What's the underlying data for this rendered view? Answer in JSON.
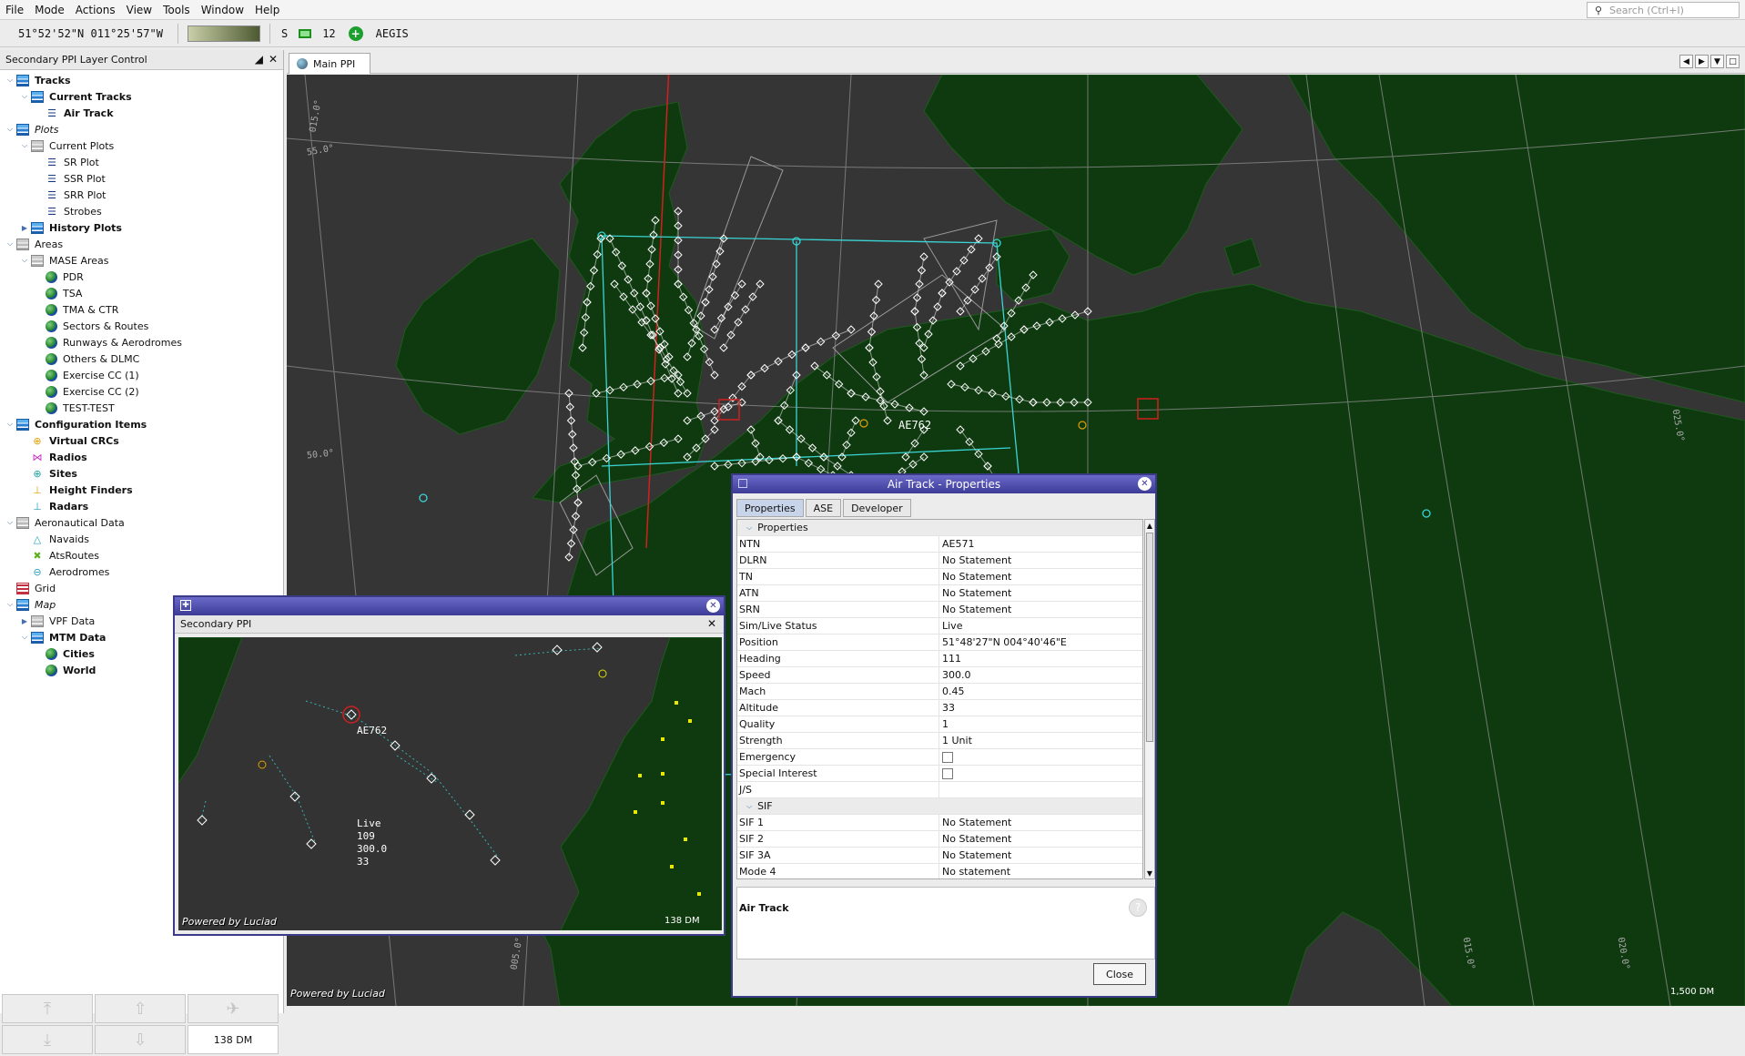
{
  "menu": [
    "File",
    "Mode",
    "Actions",
    "View",
    "Tools",
    "Window",
    "Help"
  ],
  "search": {
    "placeholder": "Search (Ctrl+I)"
  },
  "toolbar": {
    "coordinates": "51°52'52\"N 011°25'57\"W",
    "mode_letter": "S",
    "count": "12",
    "system": "AEGIS"
  },
  "left_panel": {
    "title": "Secondary PPI Layer Control",
    "tree": [
      {
        "label": "Tracks",
        "level": 0,
        "icon": "layer",
        "style": "b",
        "toggle": "open"
      },
      {
        "label": "Current Tracks",
        "level": 1,
        "icon": "layer",
        "style": "b",
        "toggle": "open"
      },
      {
        "label": "Air Track",
        "level": 2,
        "icon": "list",
        "style": "b",
        "toggle": ""
      },
      {
        "label": "Plots",
        "level": 0,
        "icon": "layer",
        "style": "i",
        "toggle": "open"
      },
      {
        "label": "Current Plots",
        "level": 1,
        "icon": "grey",
        "style": "",
        "toggle": "open"
      },
      {
        "label": "SR Plot",
        "level": 2,
        "icon": "list",
        "style": "",
        "toggle": ""
      },
      {
        "label": "SSR Plot",
        "level": 2,
        "icon": "list",
        "style": "",
        "toggle": ""
      },
      {
        "label": "SRR Plot",
        "level": 2,
        "icon": "list",
        "style": "",
        "toggle": ""
      },
      {
        "label": "Strobes",
        "level": 2,
        "icon": "list",
        "style": "",
        "toggle": ""
      },
      {
        "label": "History Plots",
        "level": 1,
        "icon": "layer",
        "style": "b",
        "toggle": "closed"
      },
      {
        "label": "Areas",
        "level": 0,
        "icon": "grey",
        "style": "",
        "toggle": "open"
      },
      {
        "label": "MASE Areas",
        "level": 1,
        "icon": "grey",
        "style": "",
        "toggle": "open"
      },
      {
        "label": "PDR",
        "level": 2,
        "icon": "globe",
        "style": "",
        "toggle": ""
      },
      {
        "label": "TSA",
        "level": 2,
        "icon": "globe",
        "style": "",
        "toggle": ""
      },
      {
        "label": "TMA & CTR",
        "level": 2,
        "icon": "globe",
        "style": "",
        "toggle": ""
      },
      {
        "label": "Sectors & Routes",
        "level": 2,
        "icon": "globe",
        "style": "",
        "toggle": ""
      },
      {
        "label": "Runways & Aerodromes",
        "level": 2,
        "icon": "globe",
        "style": "",
        "toggle": ""
      },
      {
        "label": "Others & DLMC",
        "level": 2,
        "icon": "globe",
        "style": "",
        "toggle": ""
      },
      {
        "label": "Exercise CC (1)",
        "level": 2,
        "icon": "globe",
        "style": "",
        "toggle": ""
      },
      {
        "label": "Exercise CC (2)",
        "level": 2,
        "icon": "globe",
        "style": "",
        "toggle": ""
      },
      {
        "label": "TEST-TEST",
        "level": 2,
        "icon": "globe",
        "style": "",
        "toggle": ""
      },
      {
        "label": "Configuration Items",
        "level": 0,
        "icon": "layer",
        "style": "b",
        "toggle": "open"
      },
      {
        "label": "Virtual CRCs",
        "level": 1,
        "icon": "crc",
        "style": "b",
        "toggle": ""
      },
      {
        "label": "Radios",
        "level": 1,
        "icon": "radio",
        "style": "b",
        "toggle": ""
      },
      {
        "label": "Sites",
        "level": 1,
        "icon": "site",
        "style": "b",
        "toggle": ""
      },
      {
        "label": "Height Finders",
        "level": 1,
        "icon": "hf",
        "style": "b",
        "toggle": ""
      },
      {
        "label": "Radars",
        "level": 1,
        "icon": "radar",
        "style": "b",
        "toggle": ""
      },
      {
        "label": "Aeronautical Data",
        "level": 0,
        "icon": "grey",
        "style": "",
        "toggle": "open"
      },
      {
        "label": "Navaids",
        "level": 1,
        "icon": "navaid",
        "style": "",
        "toggle": ""
      },
      {
        "label": "AtsRoutes",
        "level": 1,
        "icon": "route",
        "style": "",
        "toggle": ""
      },
      {
        "label": "Aerodromes",
        "level": 1,
        "icon": "aero",
        "style": "",
        "toggle": ""
      },
      {
        "label": "Grid",
        "level": 0,
        "icon": "grid",
        "style": "",
        "toggle": ""
      },
      {
        "label": "Map",
        "level": 0,
        "icon": "layer",
        "style": "i",
        "toggle": "open"
      },
      {
        "label": "VPF Data",
        "level": 1,
        "icon": "grey",
        "style": "",
        "toggle": "closed"
      },
      {
        "label": "MTM Data",
        "level": 1,
        "icon": "layer",
        "style": "b",
        "toggle": "open"
      },
      {
        "label": "Cities",
        "level": 2,
        "icon": "globe",
        "style": "b",
        "toggle": ""
      },
      {
        "label": "World",
        "level": 2,
        "icon": "globe",
        "style": "b",
        "toggle": ""
      }
    ],
    "range": "138 DM"
  },
  "main_tab": {
    "label": "Main PPI"
  },
  "main_map": {
    "track_label": "AE762",
    "lat1": "55.0°",
    "lat2": "50.0°",
    "lon1": "015.0°",
    "lon2": "025.0°",
    "lon3": "005.0°",
    "lon4": "015.0°",
    "lon5": "020.0°",
    "scale": "1,500 DM",
    "powered": "Powered by Luciad"
  },
  "dialog": {
    "title": "Air Track - Properties",
    "tabs": [
      "Properties",
      "ASE",
      "Developer"
    ],
    "section_properties": "Properties",
    "rows": [
      {
        "k": "NTN",
        "v": "AE571"
      },
      {
        "k": "DLRN",
        "v": "No Statement"
      },
      {
        "k": "TN",
        "v": "No Statement"
      },
      {
        "k": "ATN",
        "v": "No Statement"
      },
      {
        "k": "SRN",
        "v": "No Statement"
      },
      {
        "k": "Sim/Live Status",
        "v": "Live"
      },
      {
        "k": "Position",
        "v": "51°48'27\"N 004°40'46\"E"
      },
      {
        "k": "Heading",
        "v": "111"
      },
      {
        "k": "Speed",
        "v": "300.0"
      },
      {
        "k": "Mach",
        "v": "0.45"
      },
      {
        "k": "Altitude",
        "v": "33"
      },
      {
        "k": "Quality",
        "v": "1"
      },
      {
        "k": "Strength",
        "v": "1 Unit"
      },
      {
        "k": "Emergency",
        "v": ""
      },
      {
        "k": "Special Interest",
        "v": ""
      },
      {
        "k": "J/S",
        "v": ""
      }
    ],
    "section_sif": "SIF",
    "sif_rows": [
      {
        "k": "SIF 1",
        "v": "No Statement"
      },
      {
        "k": "SIF 2",
        "v": "No Statement"
      },
      {
        "k": "SIF 3A",
        "v": "No Statement"
      },
      {
        "k": "Mode 4",
        "v": "No statement"
      }
    ],
    "description_title": "Air Track",
    "close_label": "Close"
  },
  "secondary_ppi": {
    "tab_label": "Secondary PPI",
    "track_label": "AE762",
    "readout": [
      "Live",
      "109",
      "300.0",
      "33"
    ],
    "scale": "138 DM",
    "powered": "Powered by Luciad"
  }
}
